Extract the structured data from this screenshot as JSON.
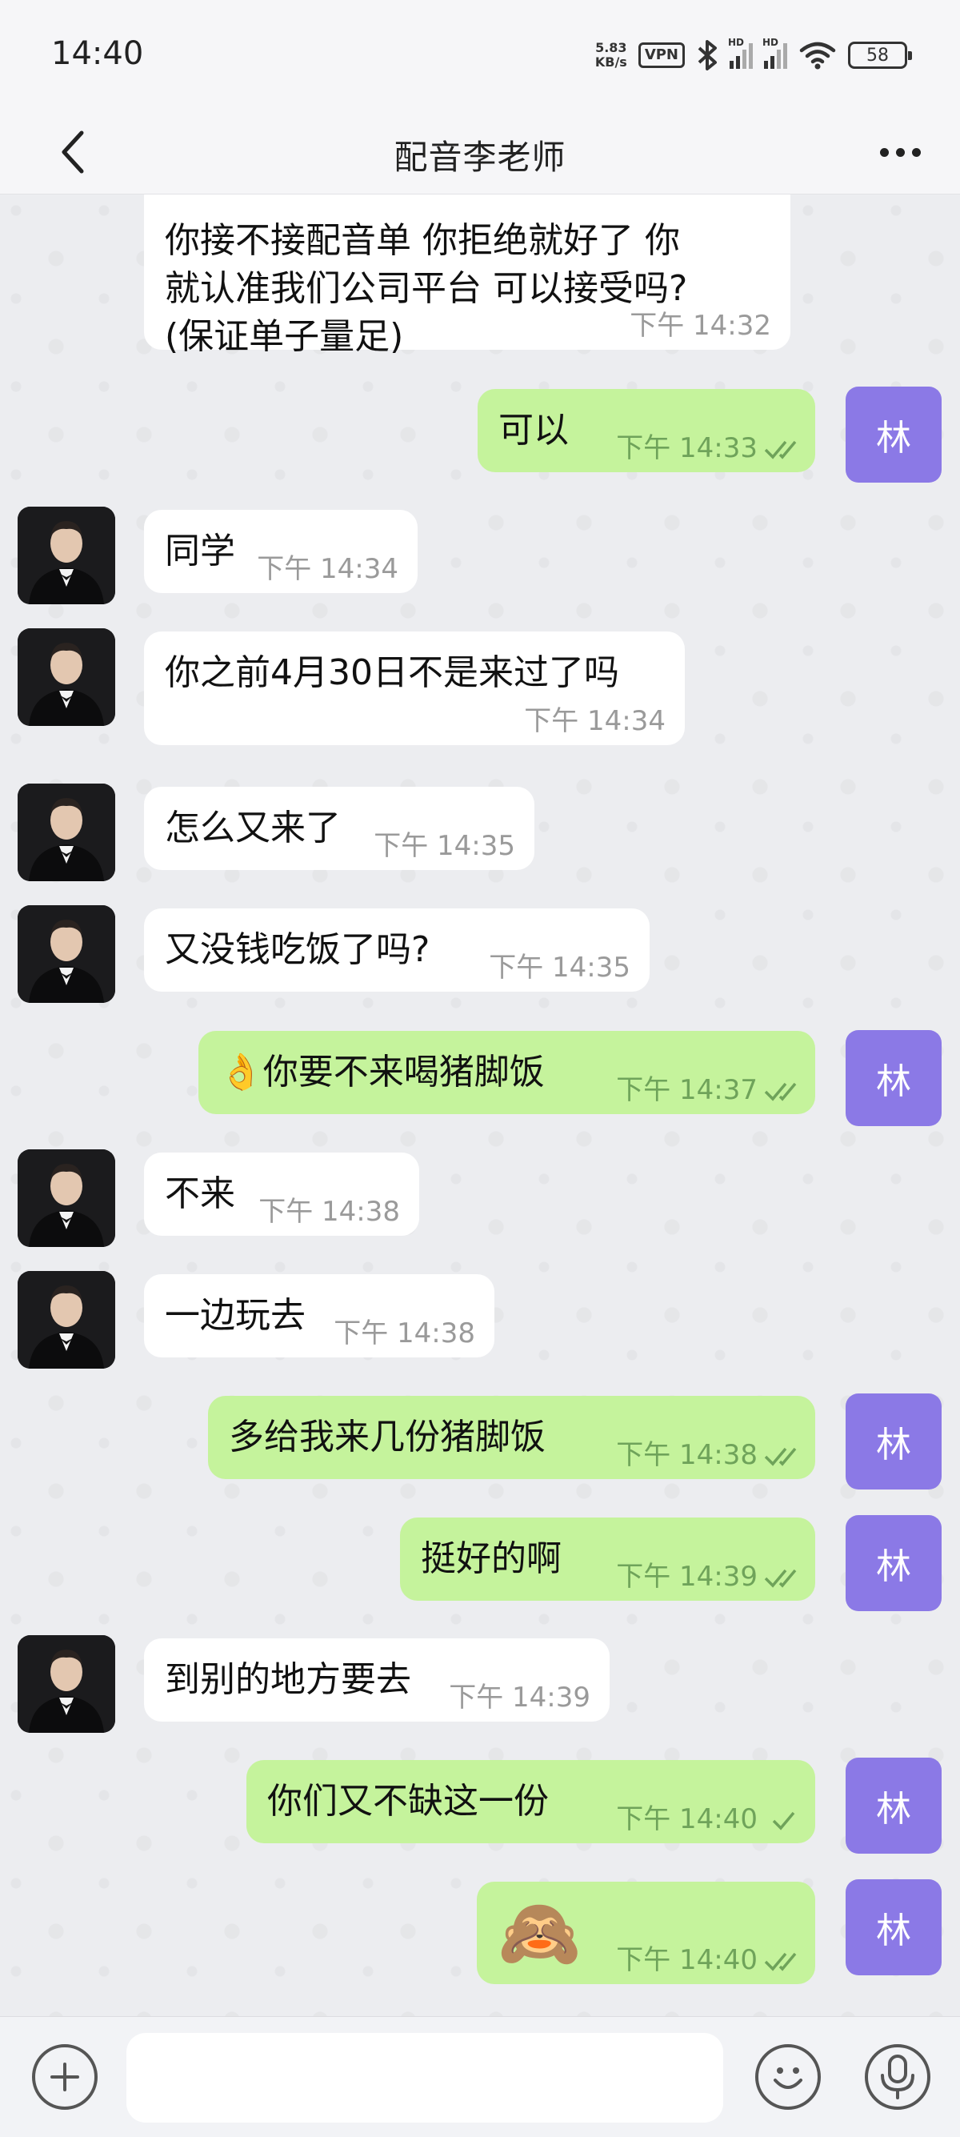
{
  "status_bar": {
    "time": "14:40",
    "net_speed_value": "5.83",
    "net_speed_unit": "KB/s",
    "vpn": "VPN",
    "signal_hd_1": "HD",
    "signal_hd_2": "HD",
    "battery": "58",
    "icons": [
      "bluetooth-icon",
      "signal-icon",
      "signal-icon",
      "wifi-icon",
      "battery-icon"
    ]
  },
  "header": {
    "title": "配音李老师",
    "back_icon": "chevron-left-icon",
    "more_icon": "more-dots-icon"
  },
  "me_avatar_label": "林",
  "messages": [
    {
      "dir": "in",
      "text_lines": [
        "你接不接配音单 你拒绝就好了  你",
        "就认准我们公司平台 可以接受吗?",
        "(保证单子量足)"
      ],
      "time": "下午 14:32"
    },
    {
      "dir": "out",
      "text": "可以",
      "time": "下午 14:33",
      "read": true
    },
    {
      "dir": "in",
      "text": "同学",
      "time": "下午 14:34"
    },
    {
      "dir": "in",
      "text": "你之前4月30日不是来过了吗",
      "time": "下午 14:34"
    },
    {
      "dir": "in",
      "text": "怎么又来了",
      "time": "下午 14:35"
    },
    {
      "dir": "in",
      "text": "又没钱吃饭了吗?",
      "time": "下午 14:35"
    },
    {
      "dir": "out",
      "text": "👌你要不来喝猪脚饭",
      "time": "下午 14:37",
      "read": true
    },
    {
      "dir": "in",
      "text": "不来",
      "time": "下午 14:38"
    },
    {
      "dir": "in",
      "text": "一边玩去",
      "time": "下午 14:38"
    },
    {
      "dir": "out",
      "text": "多给我来几份猪脚饭",
      "time": "下午 14:38",
      "read": true
    },
    {
      "dir": "out",
      "text": "挺好的啊",
      "time": "下午 14:39",
      "read": true
    },
    {
      "dir": "in",
      "text": "到别的地方要去",
      "time": "下午 14:39"
    },
    {
      "dir": "out",
      "text": "你们又不缺这一份",
      "time": "下午 14:40",
      "read": false
    },
    {
      "dir": "out",
      "text": "🙈",
      "time": "下午 14:40",
      "read": true
    }
  ],
  "composer": {
    "add_icon": "plus-circle-icon",
    "input_value": "",
    "input_placeholder": "",
    "emoji_icon": "smiley-icon",
    "mic_icon": "microphone-icon"
  },
  "colors": {
    "outgoing_bubble": "#c5f39c",
    "incoming_bubble": "#ffffff",
    "my_avatar": "#8b79e6",
    "background": "#ecedf0"
  }
}
